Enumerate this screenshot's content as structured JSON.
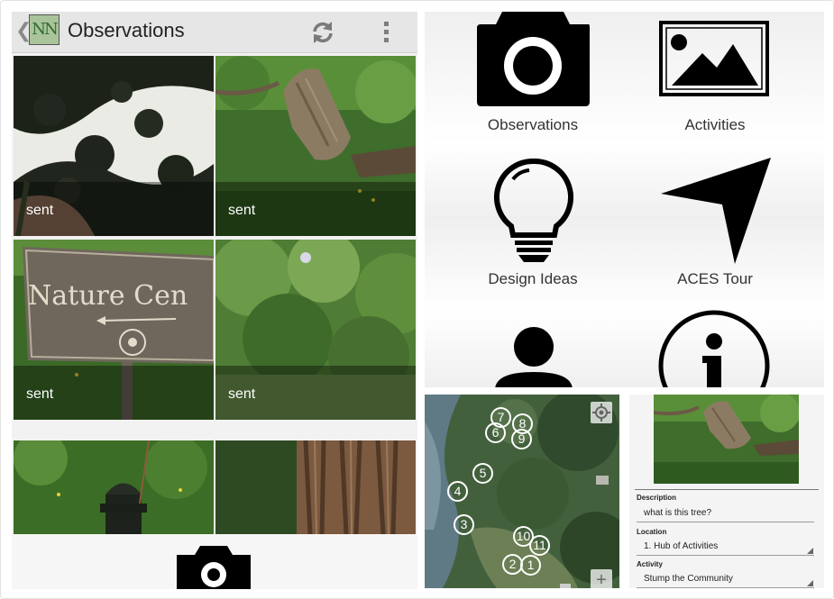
{
  "observations_screen": {
    "title": "Observations",
    "logo_text": "NN",
    "back_glyph": "❮",
    "icons": [
      "back-icon",
      "app-logo",
      "refresh-icon",
      "overflow-menu-icon",
      "camera-icon"
    ],
    "tiles": [
      {
        "status": "sent",
        "photo": "leaf-shadows"
      },
      {
        "status": "sent",
        "photo": "tree-stump"
      },
      {
        "status": "sent",
        "photo": "nature-center-sign"
      },
      {
        "status": "sent",
        "photo": "green-bushes"
      },
      {
        "status": "",
        "photo": "fire-hydrant"
      },
      {
        "status": "",
        "photo": "tree-bark"
      }
    ],
    "sign_text": "Nature Cen",
    "colors": {
      "actionbar": "#e6e6e6",
      "status_overlay": "rgba(0,0,0,0.38)"
    }
  },
  "home_menu": {
    "items": [
      {
        "label": "Observations",
        "icon": "camera-icon"
      },
      {
        "label": "Activities",
        "icon": "image-icon"
      },
      {
        "label": "Design Ideas",
        "icon": "lightbulb-icon"
      },
      {
        "label": "ACES Tour",
        "icon": "navigation-arrow-icon"
      },
      {
        "label": "",
        "icon": "person-icon"
      },
      {
        "label": "",
        "icon": "info-icon"
      }
    ]
  },
  "tour_map": {
    "markers": [
      "7",
      "8",
      "6",
      "9",
      "5",
      "4",
      "3",
      "10",
      "11",
      "2",
      "1"
    ],
    "locate_icon": "locate-icon",
    "zoom_in_label": "+"
  },
  "observation_detail": {
    "description_label": "Description",
    "description_value": "what is this tree?",
    "location_label": "Location",
    "location_value": "1. Hub of Activities",
    "activity_label": "Activity",
    "activity_value": "Stump the Community"
  }
}
